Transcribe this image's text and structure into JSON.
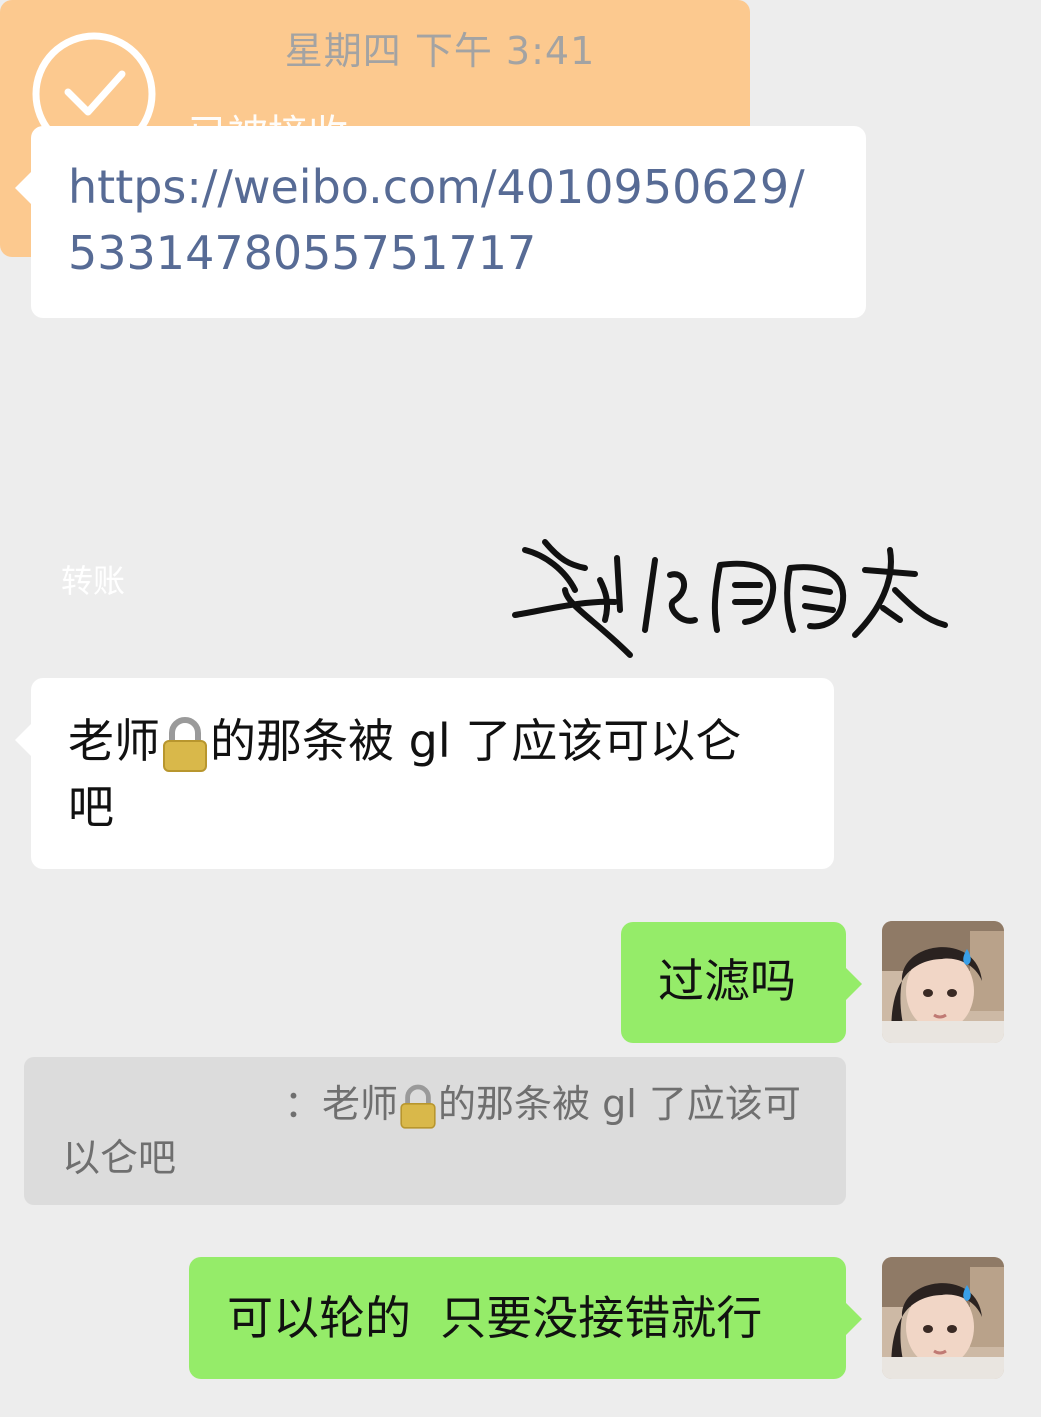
{
  "timestamp": "星期四 下午 3:41",
  "messages": {
    "link": "https://weibo.com/4010950629/5331478055751717",
    "transfer": {
      "status": "已被接收",
      "kind": "转账",
      "accent": "#fcc98f"
    },
    "teacher": {
      "before_lock": "老师",
      "after_lock": "的那条被 gl 了应该可以仑",
      "line2": "吧"
    },
    "filter": "过滤吗",
    "quote": {
      "sep": "：",
      "before_lock": "老师",
      "after_lock": "的那条被 gl 了应该可",
      "line2": "以仑吧"
    },
    "reply": "可以轮的  只要没接错就行"
  },
  "watermark_text": "兴证周周太",
  "colors": {
    "background": "#ededed",
    "incoming_bubble": "#ffffff",
    "outgoing_bubble": "#95ec69",
    "link": "#576b95",
    "quote_bg": "#dcdcdc"
  },
  "icons": {
    "lock": "lock-icon",
    "check": "check-circle-icon",
    "avatar": "avatar-icon"
  }
}
